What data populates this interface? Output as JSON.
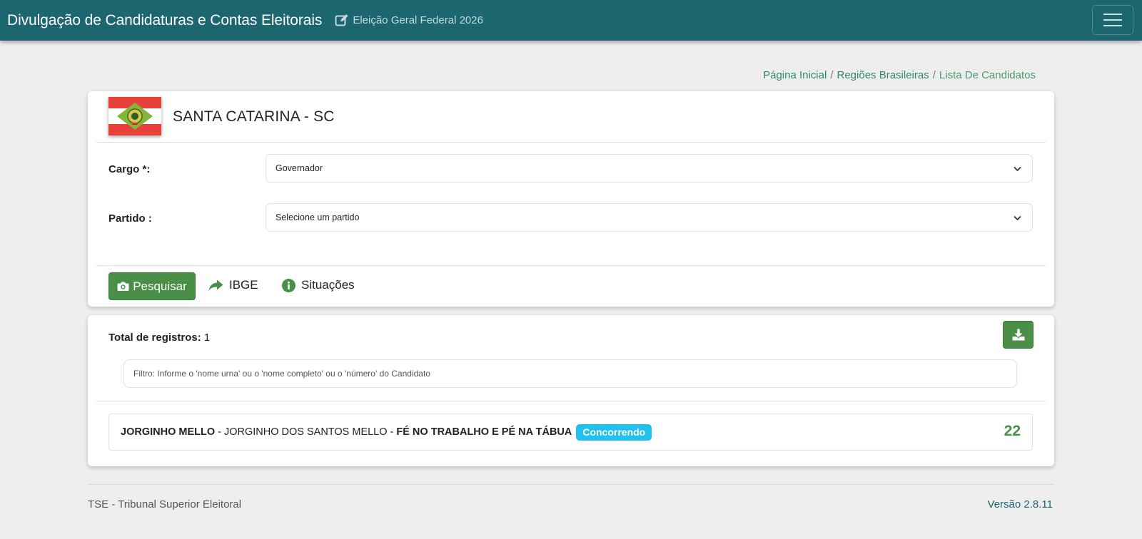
{
  "header": {
    "brand": "Divulgação de Candidaturas e Contas Eleitorais",
    "election": "Eleição Geral Federal 2026",
    "bg_color": "#1c6670"
  },
  "breadcrumb": {
    "items": [
      "Página Inicial",
      "Regiões Brasileiras",
      "Lista De Candidatos"
    ],
    "separator": "/"
  },
  "state": {
    "title": "SANTA CATARINA - SC"
  },
  "form": {
    "cargo_label": "Cargo *:",
    "cargo_value": "Governador",
    "partido_label": "Partido :",
    "partido_value": "Selecione um partido"
  },
  "actions": {
    "search": "Pesquisar",
    "ibge": "IBGE",
    "situacoes": "Situações"
  },
  "results": {
    "total_label": "Total de registros:",
    "total_value": "1",
    "filter_placeholder": "Filtro: Informe o 'nome urna' ou o 'nome completo' ou o 'número' do Candidato",
    "candidates": [
      {
        "nome_urna": "JORGINHO MELLO",
        "nome_completo": "JORGINHO DOS SANTOS MELLO",
        "coligacao": "FÉ NO TRABALHO E PÉ NA TÁBUA",
        "status": "Concorrendo",
        "numero": "22"
      }
    ]
  },
  "footer": {
    "left": "TSE - Tribunal Superior Eleitoral",
    "right": "Versão 2.8.11"
  },
  "colors": {
    "accent_green": "#4a8f47",
    "badge_cyan": "#1fc2ee",
    "link_green": "#2f8a61"
  },
  "icons": {
    "election": "edit-icon",
    "menu": "hamburger-icon",
    "search": "camera-icon",
    "ibge": "share-arrow-icon",
    "situacoes": "info-circle-icon",
    "download": "download-icon",
    "select": "chevron-down-icon"
  }
}
